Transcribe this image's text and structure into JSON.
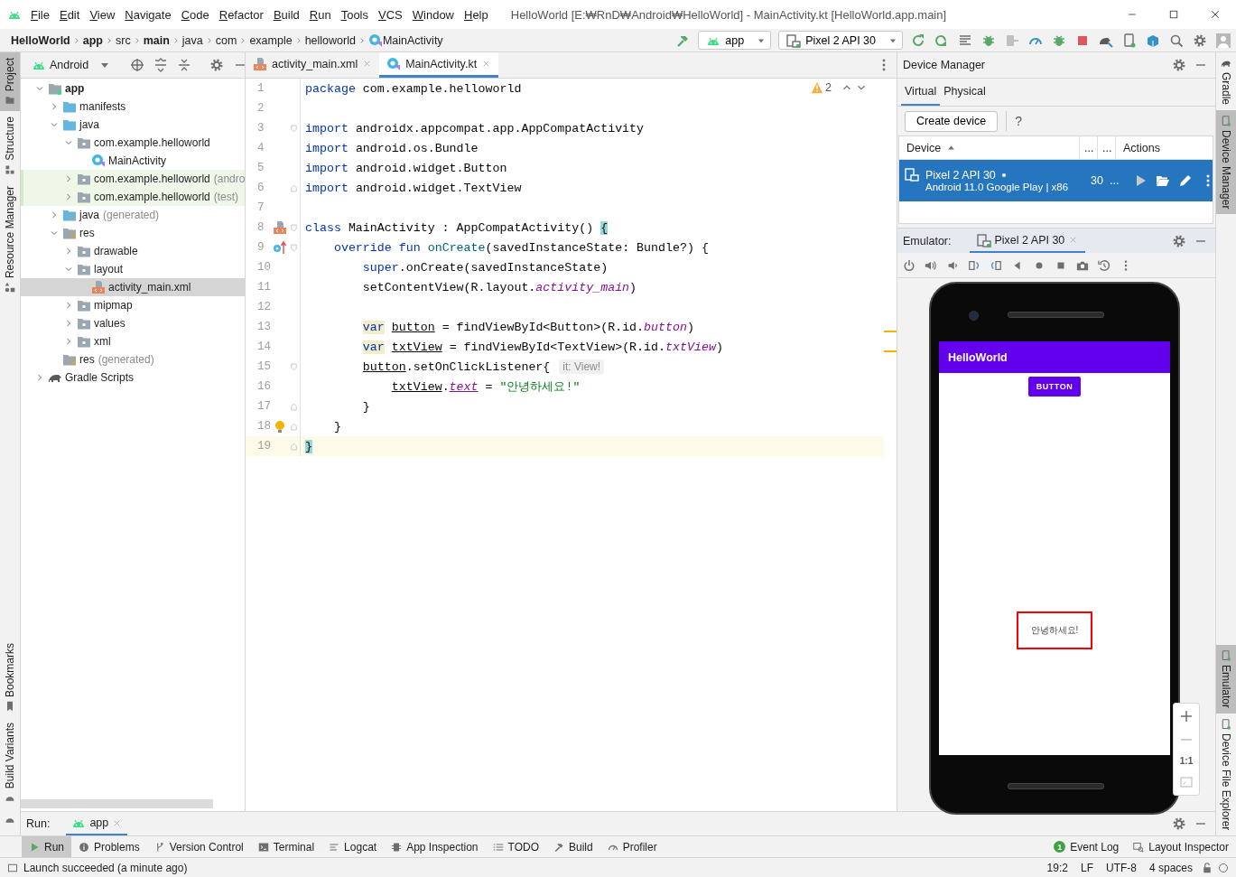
{
  "menu_bar": {
    "items": [
      "File",
      "Edit",
      "View",
      "Navigate",
      "Code",
      "Refactor",
      "Build",
      "Run",
      "Tools",
      "VCS",
      "Window",
      "Help"
    ],
    "title": "HelloWorld [E:₩RnD₩Android₩HelloWorld] - MainActivity.kt [HelloWorld.app.main]"
  },
  "breadcrumb": [
    {
      "label": "HelloWorld",
      "kind": "module"
    },
    {
      "label": "app",
      "kind": "module"
    },
    {
      "label": "src",
      "kind": "dir"
    },
    {
      "label": "main",
      "kind": "module"
    },
    {
      "label": "java",
      "kind": "dir"
    },
    {
      "label": "com",
      "kind": "dir"
    },
    {
      "label": "example",
      "kind": "dir"
    },
    {
      "label": "helloworld",
      "kind": "dir"
    },
    {
      "label": "MainActivity",
      "kind": "class"
    }
  ],
  "run_config": {
    "module": "app",
    "device": "Pixel 2 API 30"
  },
  "left_stripe": {
    "top": [
      {
        "label": "Project",
        "selected": true
      },
      {
        "label": "Structure",
        "selected": false
      },
      {
        "label": "Resource Manager",
        "selected": false
      }
    ],
    "bottom": [
      {
        "label": "Bookmarks",
        "selected": false
      },
      {
        "label": "Build Variants",
        "selected": false
      }
    ]
  },
  "project": {
    "view": "Android",
    "tree": [
      {
        "label": "app",
        "kind": "module",
        "expanded": true,
        "selected": false,
        "highlighted": false,
        "children": [
          {
            "label": "manifests",
            "kind": "source-folder",
            "expanded": false,
            "selected": false,
            "highlighted": false
          },
          {
            "label": "java",
            "kind": "source-folder",
            "expanded": true,
            "selected": false,
            "highlighted": false,
            "children": [
              {
                "label": "com.example.helloworld",
                "kind": "package",
                "expanded": true,
                "selected": false,
                "highlighted": false,
                "children": [
                  {
                    "label": "MainActivity",
                    "kind": "class",
                    "selected": false,
                    "highlighted": false
                  }
                ]
              },
              {
                "label": "com.example.helloworld",
                "note": "(andro",
                "kind": "package",
                "expanded": false,
                "selected": false,
                "highlighted": true
              },
              {
                "label": "com.example.helloworld",
                "note": "(test)",
                "kind": "package",
                "expanded": false,
                "selected": false,
                "highlighted": true
              }
            ]
          },
          {
            "label": "java",
            "note": "(generated)",
            "kind": "generated",
            "expanded": false,
            "selected": false,
            "highlighted": false
          },
          {
            "label": "res",
            "kind": "res",
            "expanded": true,
            "selected": false,
            "highlighted": false,
            "children": [
              {
                "label": "drawable",
                "kind": "package",
                "expanded": false,
                "selected": false,
                "highlighted": false
              },
              {
                "label": "layout",
                "kind": "package",
                "expanded": true,
                "selected": false,
                "highlighted": false,
                "children": [
                  {
                    "label": "activity_main.xml",
                    "kind": "layout-file",
                    "selected": true,
                    "highlighted": false
                  }
                ]
              },
              {
                "label": "mipmap",
                "kind": "package",
                "expanded": false,
                "selected": false,
                "highlighted": false
              },
              {
                "label": "values",
                "kind": "package",
                "expanded": false,
                "selected": false,
                "highlighted": false
              },
              {
                "label": "xml",
                "kind": "package",
                "expanded": false,
                "selected": false,
                "highlighted": false
              }
            ]
          },
          {
            "label": "res",
            "note": "(generated)",
            "kind": "res",
            "selected": false,
            "highlighted": false
          }
        ]
      },
      {
        "label": "Gradle Scripts",
        "kind": "gradle",
        "expanded": false,
        "selected": false,
        "highlighted": false
      }
    ]
  },
  "editor": {
    "tabs": [
      {
        "label": "activity_main.xml",
        "kind": "layout-file",
        "selected": false
      },
      {
        "label": "MainActivity.kt",
        "kind": "class",
        "selected": true
      }
    ],
    "warnings": "2",
    "lines": [
      {
        "number": "1",
        "current": false,
        "warning": false,
        "tokens": [
          {
            "kind": "keyword",
            "text": "package"
          },
          {
            "kind": "plain",
            "text": " com.example.helloworld"
          }
        ]
      },
      {
        "number": "2",
        "current": false,
        "warning": false
      },
      {
        "number": "3",
        "current": false,
        "warning": false,
        "fold": {
          "kind": "start"
        },
        "tokens": [
          {
            "kind": "keyword",
            "text": "import"
          },
          {
            "kind": "plain",
            "text": " androidx.appcompat.app.AppCompatActivity"
          }
        ]
      },
      {
        "number": "4",
        "current": false,
        "warning": false,
        "tokens": [
          {
            "kind": "keyword",
            "text": "import"
          },
          {
            "kind": "plain",
            "text": " android.os.Bundle"
          }
        ]
      },
      {
        "number": "5",
        "current": false,
        "warning": false,
        "tokens": [
          {
            "kind": "keyword",
            "text": "import"
          },
          {
            "kind": "plain",
            "text": " android.widget.Button"
          }
        ]
      },
      {
        "number": "6",
        "current": false,
        "warning": false,
        "fold": {
          "kind": "end"
        },
        "tokens": [
          {
            "kind": "keyword",
            "text": "import"
          },
          {
            "kind": "plain",
            "text": " android.widget.TextView"
          }
        ]
      },
      {
        "number": "7",
        "current": false,
        "warning": false
      },
      {
        "number": "8",
        "current": false,
        "warning": false,
        "fold": {
          "kind": "start"
        },
        "marker": {
          "kind": "layout"
        },
        "tokens": [
          {
            "kind": "keyword",
            "text": "class"
          },
          {
            "kind": "plain",
            "text": " MainActivity : AppCompatActivity() "
          },
          {
            "kind": "brace",
            "text": "{"
          }
        ]
      },
      {
        "number": "9",
        "current": false,
        "warning": false,
        "fold": {
          "kind": "start"
        },
        "marker": {
          "kind": "override"
        },
        "tokens": [
          {
            "kind": "keyword",
            "text": "    override"
          },
          {
            "kind": "keyword",
            "text": " fun"
          },
          {
            "kind": "function",
            "text": " onCreate"
          },
          {
            "kind": "plain",
            "text": "(savedInstanceState: Bundle?) {"
          }
        ]
      },
      {
        "number": "10",
        "current": false,
        "warning": false,
        "tokens": [
          {
            "kind": "keyword",
            "text": "        super"
          },
          {
            "kind": "plain",
            "text": ".onCreate(savedInstanceState)"
          }
        ]
      },
      {
        "number": "11",
        "current": false,
        "warning": false,
        "tokens": [
          {
            "kind": "plain",
            "text": "        setContentView(R.layout."
          },
          {
            "kind": "member",
            "text": "activity_main"
          },
          {
            "kind": "plain",
            "text": ")"
          }
        ]
      },
      {
        "number": "12",
        "current": false,
        "warning": false
      },
      {
        "number": "13",
        "current": false,
        "warning": true,
        "tokens": [
          {
            "kind": "weak-keyword",
            "text": "        var"
          },
          {
            "kind": "reference",
            "text": " button"
          },
          {
            "kind": "plain",
            "text": " = findViewById<Button>(R.id."
          },
          {
            "kind": "member",
            "text": "button"
          },
          {
            "kind": "plain",
            "text": ")"
          }
        ]
      },
      {
        "number": "14",
        "current": false,
        "warning": true,
        "tokens": [
          {
            "kind": "weak-keyword",
            "text": "        var"
          },
          {
            "kind": "reference",
            "text": " txtView"
          },
          {
            "kind": "plain",
            "text": " = findViewById<TextView>(R.id."
          },
          {
            "kind": "member",
            "text": "txtView"
          },
          {
            "kind": "plain",
            "text": ")"
          }
        ]
      },
      {
        "number": "15",
        "current": false,
        "warning": false,
        "fold": {
          "kind": "start"
        },
        "tokens": [
          {
            "kind": "reference",
            "text": "        button"
          },
          {
            "kind": "plain",
            "text": ".setOnClickListener{"
          },
          {
            "kind": "hint",
            "text": "it: View!"
          }
        ]
      },
      {
        "number": "16",
        "current": false,
        "warning": false,
        "tokens": [
          {
            "kind": "reference",
            "text": "            txtView"
          },
          {
            "kind": "plain",
            "text": "."
          },
          {
            "kind": "member-reference",
            "text": "text"
          },
          {
            "kind": "plain",
            "text": " = "
          },
          {
            "kind": "string",
            "text": "\"안녕하세요!\""
          }
        ]
      },
      {
        "number": "17",
        "current": false,
        "warning": false,
        "fold": {
          "kind": "end"
        },
        "tokens": [
          {
            "kind": "plain",
            "text": "        }"
          }
        ]
      },
      {
        "number": "18",
        "current": false,
        "warning": false,
        "fold": {
          "kind": "end"
        },
        "marker": {
          "kind": "bulb"
        },
        "tokens": [
          {
            "kind": "plain",
            "text": "    }"
          }
        ]
      },
      {
        "number": "19",
        "current": true,
        "warning": false,
        "fold": {
          "kind": "end"
        },
        "tokens": [
          {
            "kind": "brace",
            "text": "}"
          }
        ]
      }
    ]
  },
  "device_manager": {
    "title": "Device Manager",
    "tabs": [
      {
        "label": "Virtual",
        "selected": true
      },
      {
        "label": "Physical",
        "selected": false
      }
    ],
    "create_button": "Create device",
    "help": "?",
    "columns": [
      "Device",
      "...",
      "...",
      "Actions"
    ],
    "rows": [
      {
        "name": "Pixel 2 API 30",
        "details": "Android 11.0 Google Play | x86",
        "api": "30",
        "size": "...",
        "running": true,
        "selected": true
      }
    ]
  },
  "emulator": {
    "label": "Emulator:",
    "tab": "Pixel 2 API 30",
    "app": {
      "title": "HelloWorld",
      "button": "BUTTON",
      "text": "안녕하세요!"
    },
    "zoom_label": "1:1"
  },
  "right_stripe": {
    "top": [
      {
        "label": "Gradle",
        "selected": false
      },
      {
        "label": "Device Manager",
        "selected": true
      }
    ],
    "bottom": [
      {
        "label": "Emulator",
        "selected": true
      },
      {
        "label": "Device File Explorer",
        "selected": false
      }
    ]
  },
  "run_panel": {
    "label": "Run:",
    "tab": "app"
  },
  "tool_windows": {
    "left": [
      {
        "label": "Run",
        "selected": true
      },
      {
        "label": "Problems",
        "selected": false
      },
      {
        "label": "Version Control",
        "selected": false
      },
      {
        "label": "Terminal",
        "selected": false
      },
      {
        "label": "Logcat",
        "selected": false
      },
      {
        "label": "App Inspection",
        "selected": false
      },
      {
        "label": "TODO",
        "selected": false
      },
      {
        "label": "Build",
        "selected": false
      },
      {
        "label": "Profiler",
        "selected": false
      }
    ],
    "right": [
      {
        "label": "Event Log",
        "badge": "1"
      },
      {
        "label": "Layout Inspector"
      }
    ]
  },
  "status_bar": {
    "message": "Launch succeeded (a minute ago)",
    "items": [
      "19:2",
      "LF",
      "UTF-8",
      "4 spaces"
    ]
  }
}
